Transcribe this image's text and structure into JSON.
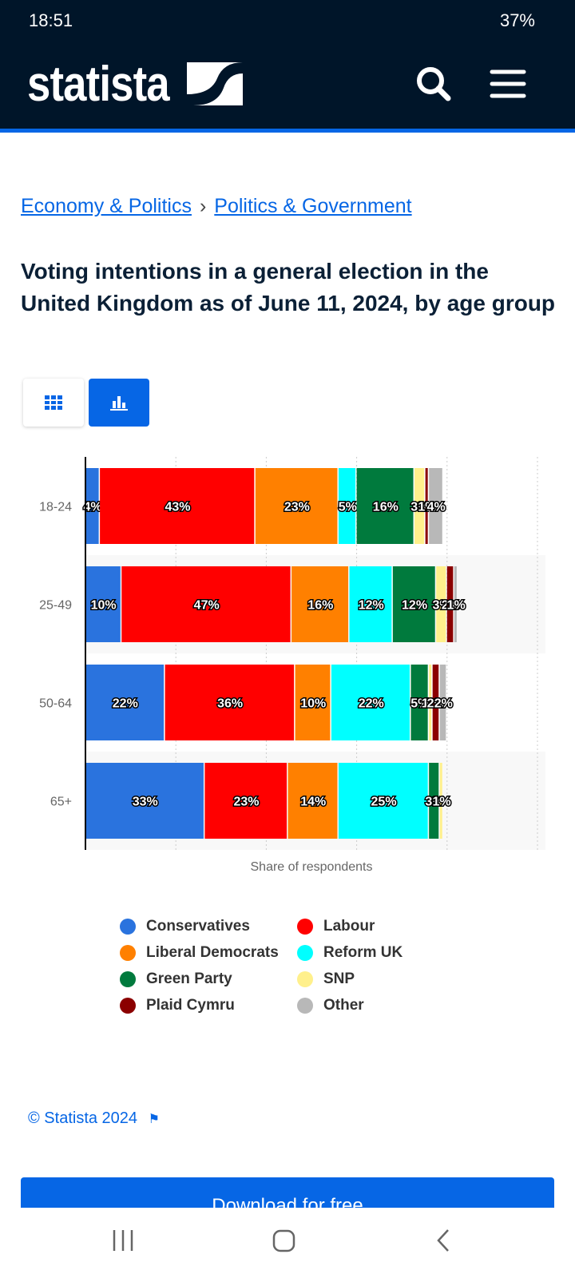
{
  "status_bar": {
    "time": "18:51",
    "battery": "37%"
  },
  "header": {
    "logo": "statista"
  },
  "breadcrumb": [
    {
      "label": "Economy & Politics"
    },
    {
      "label": "Politics & Government"
    }
  ],
  "breadcrumb_sep": "›",
  "title": "Voting intentions in a general election in the United Kingdom as of June 11, 2024, by age group",
  "colors": {
    "accent": "#0666e5",
    "header_bg": "#001529"
  },
  "chart_data": {
    "type": "bar",
    "orientation": "horizontal",
    "stacked": true,
    "categories": [
      "18-24",
      "25-49",
      "50-64",
      "65+"
    ],
    "xlabel": "Share of respondents",
    "xlim": [
      0,
      125
    ],
    "grid": true,
    "legend_position": "bottom",
    "series": [
      {
        "name": "Conservatives",
        "color": "#2a73de",
        "values": [
          4,
          10,
          22,
          33
        ]
      },
      {
        "name": "Labour",
        "color": "#ff0000",
        "values": [
          43,
          47,
          36,
          23
        ]
      },
      {
        "name": "Liberal Democrats",
        "color": "#ff8000",
        "values": [
          23,
          16,
          10,
          14
        ]
      },
      {
        "name": "Reform UK",
        "color": "#00ffff",
        "values": [
          5,
          12,
          22,
          25
        ]
      },
      {
        "name": "Green Party",
        "color": "#007a3d",
        "values": [
          16,
          12,
          5,
          3
        ]
      },
      {
        "name": "SNP",
        "color": "#fff08c",
        "values": [
          3,
          3,
          1,
          1
        ]
      },
      {
        "name": "Plaid Cymru",
        "color": "#8b0000",
        "values": [
          1,
          2,
          2,
          0
        ]
      },
      {
        "name": "Other",
        "color": "#b8b8b8",
        "values": [
          4,
          1,
          2,
          0
        ]
      }
    ]
  },
  "credit": "© Statista 2024",
  "download_label": "Download for free"
}
